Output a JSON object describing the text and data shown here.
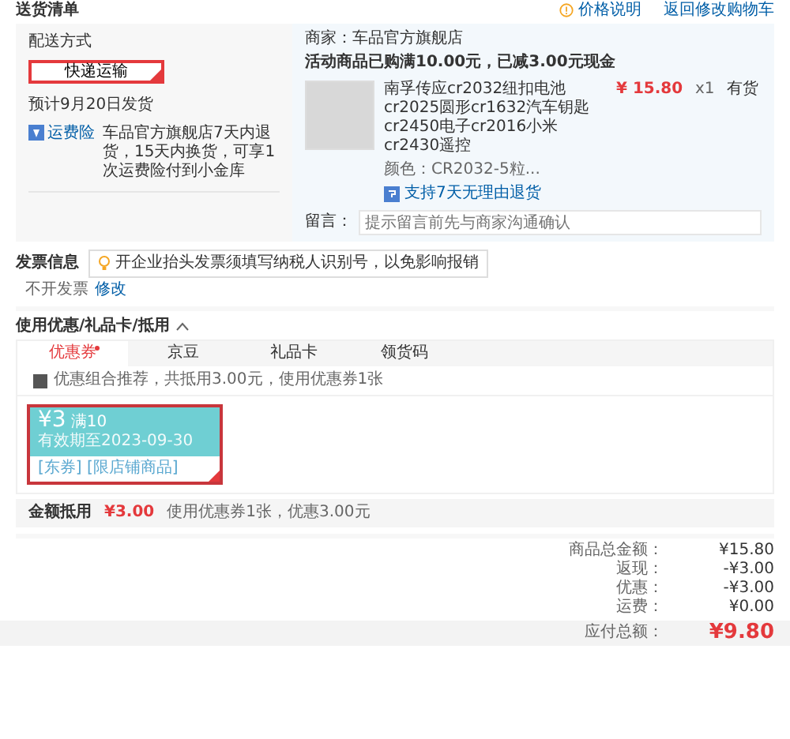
{
  "header": {
    "title": "送货清单",
    "links": [
      "价格说明",
      "返回修改购物车"
    ]
  },
  "delivery": {
    "label": "配送方式",
    "options": [
      {
        "label": "快递运输",
        "selected": true
      }
    ],
    "estimate": "预计9月20日发货",
    "service_tag": "运费险",
    "service_text": "车品官方旗舰店7天内退货，15天内换货，可享1次运费险付到小金库"
  },
  "shop": {
    "seller": "商家：车品官方旗舰店",
    "promo": "活动商品已购满10.00元，已减3.00元现金",
    "items": [
      {
        "title": "南孚传应cr2032纽扣电池cr2025圆形cr1632汽车钥匙cr2450电子cr2016小米cr2430遥控",
        "variant": "颜色：CR2032-5粒...",
        "price": "¥ 15.80",
        "qty": "x1",
        "stock": "有货",
        "service": "支持7天无理由退货"
      }
    ],
    "note_label": "留言：",
    "note_placeholder": "提示留言前先与商家沟通确认"
  },
  "invoice": {
    "title": "发票信息",
    "notice": "开企业抬头发票须填写纳税人识别号，以免影响报销",
    "value": "不开发票",
    "edit": "修改"
  },
  "discounts": {
    "title": "使用优惠/礼品卡/抵用",
    "expanded": true,
    "tabs": [
      {
        "label": "优惠券",
        "selected": true,
        "dot": true
      },
      {
        "label": "京豆",
        "selected": false,
        "dot": false
      },
      {
        "label": "礼品卡",
        "selected": false,
        "dot": false
      },
      {
        "label": "领货码",
        "selected": false,
        "dot": false
      }
    ],
    "recommend": {
      "checked": true,
      "text": "优惠组合推荐，共抵用3.00元，使用优惠券1张"
    },
    "coupons": [
      {
        "amount": "¥3",
        "condition": "满10",
        "expiry": "有效期至2023-09-30",
        "scope": "[东券] [限店铺商品]",
        "selected": true
      }
    ],
    "summary_label": "金额抵用",
    "summary_amount": "¥3.00",
    "summary_text": "使用优惠券1张，优惠3.00元"
  },
  "totals": [
    {
      "label": "商品总金额：",
      "value": "¥15.80"
    },
    {
      "label": "返现：",
      "value": "-¥3.00"
    },
    {
      "label": "优惠：",
      "value": "-¥3.00"
    },
    {
      "label": "运费：",
      "value": "¥0.00"
    }
  ],
  "payable": {
    "label": "应付总额：",
    "value": "¥9.80"
  }
}
